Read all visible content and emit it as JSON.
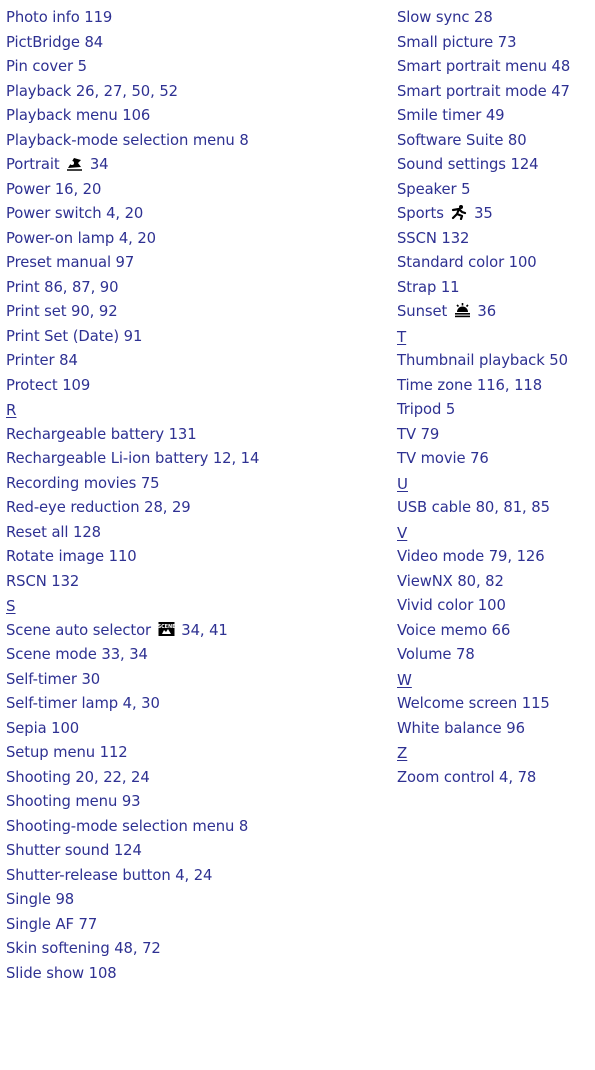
{
  "left_column": [
    {
      "type": "entry",
      "text": "Photo info 119"
    },
    {
      "type": "entry",
      "text": "PictBridge 84"
    },
    {
      "type": "entry",
      "text": "Pin cover 5"
    },
    {
      "type": "entry",
      "text": "Playback 26, 27, 50, 52"
    },
    {
      "type": "entry",
      "text": "Playback menu 106"
    },
    {
      "type": "entry",
      "text": "Playback-mode selection menu 8"
    },
    {
      "type": "entry",
      "text": "Portrait",
      "icon": "portrait-icon",
      "pages": "34"
    },
    {
      "type": "entry",
      "text": "Power 16, 20"
    },
    {
      "type": "entry",
      "text": "Power switch 4, 20"
    },
    {
      "type": "entry",
      "text": "Power-on lamp 4, 20"
    },
    {
      "type": "entry",
      "text": "Preset manual 97"
    },
    {
      "type": "entry",
      "text": "Print 86, 87, 90"
    },
    {
      "type": "entry",
      "text": "Print set 90, 92"
    },
    {
      "type": "entry",
      "text": "Print Set (Date) 91"
    },
    {
      "type": "entry",
      "text": "Printer 84"
    },
    {
      "type": "entry",
      "text": "Protect 109"
    },
    {
      "type": "letter",
      "text": "R"
    },
    {
      "type": "entry",
      "text": "Rechargeable battery 131"
    },
    {
      "type": "entry",
      "text": "Rechargeable Li-ion battery 12, 14"
    },
    {
      "type": "entry",
      "text": "Recording movies 75"
    },
    {
      "type": "entry",
      "text": "Red-eye reduction 28, 29"
    },
    {
      "type": "entry",
      "text": "Reset all 128"
    },
    {
      "type": "entry",
      "text": "Rotate image 110"
    },
    {
      "type": "entry",
      "text": "RSCN 132"
    },
    {
      "type": "letter",
      "text": "S"
    },
    {
      "type": "entry",
      "text": "Scene auto selector",
      "icon": "scene-auto-icon",
      "pages": "34, 41"
    },
    {
      "type": "entry",
      "text": "Scene mode 33, 34"
    },
    {
      "type": "entry",
      "text": "Self-timer 30"
    },
    {
      "type": "entry",
      "text": "Self-timer lamp 4, 30"
    },
    {
      "type": "entry",
      "text": "Sepia 100"
    },
    {
      "type": "entry",
      "text": "Setup menu 112"
    },
    {
      "type": "entry",
      "text": "Shooting 20, 22, 24"
    },
    {
      "type": "entry",
      "text": "Shooting menu 93"
    },
    {
      "type": "entry",
      "text": "Shooting-mode selection menu 8"
    },
    {
      "type": "entry",
      "text": "Shutter sound 124"
    },
    {
      "type": "entry",
      "text": "Shutter-release button 4, 24"
    },
    {
      "type": "entry",
      "text": "Single 98"
    },
    {
      "type": "entry",
      "text": "Single AF 77"
    },
    {
      "type": "entry",
      "text": "Skin softening 48, 72"
    },
    {
      "type": "entry",
      "text": "Slide show 108"
    }
  ],
  "right_column": [
    {
      "type": "entry",
      "text": "Slow sync 28"
    },
    {
      "type": "entry",
      "text": "Small picture 73"
    },
    {
      "type": "entry",
      "text": "Smart portrait menu 48"
    },
    {
      "type": "entry",
      "text": "Smart portrait mode 47"
    },
    {
      "type": "entry",
      "text": "Smile timer 49"
    },
    {
      "type": "entry",
      "text": "Software Suite 80"
    },
    {
      "type": "entry",
      "text": "Sound settings 124"
    },
    {
      "type": "entry",
      "text": "Speaker 5"
    },
    {
      "type": "entry",
      "text": "Sports",
      "icon": "sports-icon",
      "pages": "35"
    },
    {
      "type": "entry",
      "text": "SSCN 132"
    },
    {
      "type": "entry",
      "text": "Standard color 100"
    },
    {
      "type": "entry",
      "text": "Strap 11"
    },
    {
      "type": "entry",
      "text": "Sunset",
      "icon": "sunset-icon",
      "pages": "36"
    },
    {
      "type": "letter",
      "text": "T"
    },
    {
      "type": "entry",
      "text": "Thumbnail playback 50"
    },
    {
      "type": "entry",
      "text": "Time zone 116, 118"
    },
    {
      "type": "entry",
      "text": "Tripod 5"
    },
    {
      "type": "entry",
      "text": "TV 79"
    },
    {
      "type": "entry",
      "text": "TV movie 76"
    },
    {
      "type": "letter",
      "text": "U"
    },
    {
      "type": "entry",
      "text": "USB cable 80, 81, 85"
    },
    {
      "type": "letter",
      "text": "V"
    },
    {
      "type": "entry",
      "text": "Video mode 79, 126"
    },
    {
      "type": "entry",
      "text": "ViewNX 80, 82"
    },
    {
      "type": "entry",
      "text": "Vivid color 100"
    },
    {
      "type": "entry",
      "text": "Voice memo 66"
    },
    {
      "type": "entry",
      "text": "Volume 78"
    },
    {
      "type": "letter",
      "text": "W"
    },
    {
      "type": "entry",
      "text": "Welcome screen 115"
    },
    {
      "type": "entry",
      "text": "White balance 96"
    },
    {
      "type": "letter",
      "text": "Z"
    },
    {
      "type": "entry",
      "text": "Zoom control 4, 78"
    }
  ],
  "colors": {
    "text": "#2e3192",
    "icon": "#000000"
  }
}
